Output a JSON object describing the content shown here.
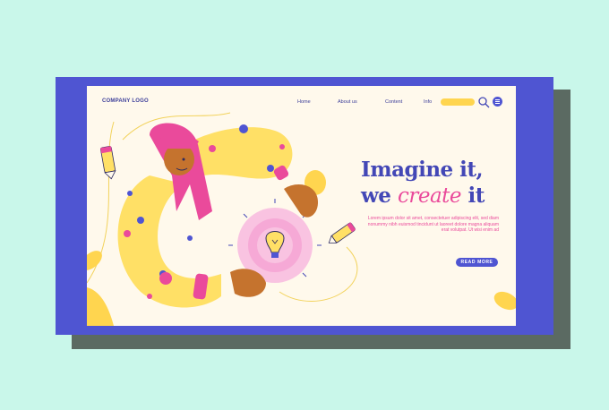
{
  "nav": {
    "logo": "COMPANY LOGO",
    "links": [
      "Home",
      "About us",
      "Content",
      "Info"
    ]
  },
  "hero": {
    "title_line1": "Imagine it,",
    "title_line2_prefix": "we ",
    "title_line2_accent": "create",
    "title_line2_suffix": " it",
    "body": "Lorem ipsum dolor sit amet, consectetuer adipiscing elit, sed diam nonummy nibh euismod tincidunt ut laoreet dolore magna aliquam erat volutpat. Ut wisi enim ad",
    "cta": "READ MORE"
  },
  "colors": {
    "background": "#c9f7ea",
    "frame": "#4f55d2",
    "page": "#fff9ec",
    "primary": "#4347b6",
    "accent_pink": "#ea4a9b",
    "accent_yellow": "#ffd54f"
  },
  "icons": [
    "search-icon",
    "menu-icon",
    "pencil-icon",
    "lightbulb-icon"
  ]
}
